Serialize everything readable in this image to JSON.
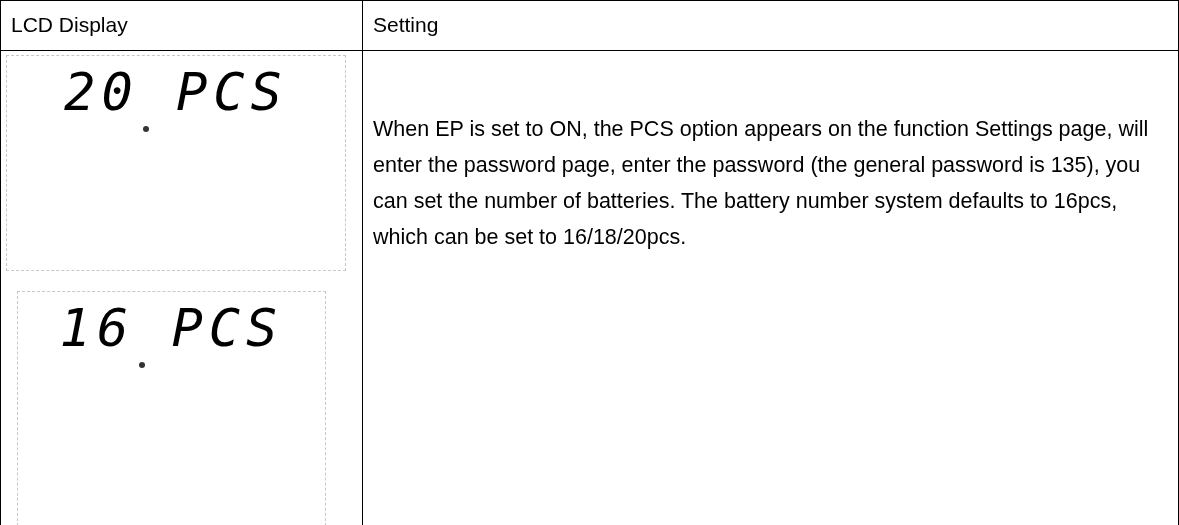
{
  "table": {
    "columns": [
      "LCD Display",
      "Setting"
    ],
    "row": {
      "lcd_displays": [
        {
          "reading": "20 PCS"
        },
        {
          "reading": "16 PCS"
        }
      ],
      "setting": "When EP is set to ON, the PCS option appears on the function Settings page, will enter the password page, enter the password (the general password is 135), you can set the number of batteries. The battery number system defaults to 16pcs, which can be set to 16/18/20pcs."
    }
  }
}
